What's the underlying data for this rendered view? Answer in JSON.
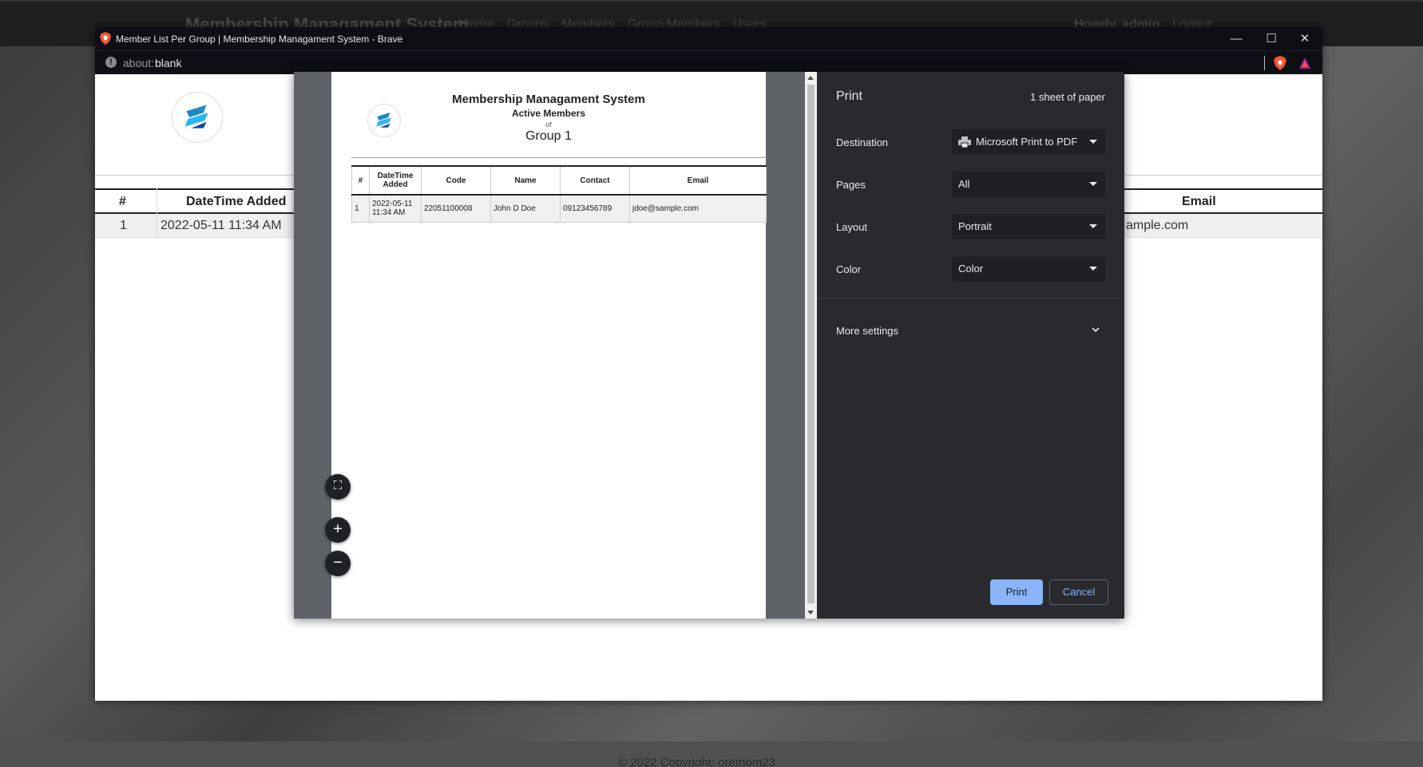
{
  "background_app": {
    "brand": "Membership Managament System",
    "nav": [
      "Home",
      "Groups",
      "Members",
      "Group Members",
      "Users"
    ],
    "user_greeting": "Howdy, admin",
    "logout": "Logout",
    "footer": "© 2022 Copyright: oretnom23"
  },
  "window": {
    "title": "Member List Per Group | Membership Managament System - Brave",
    "address_prefix": "about:",
    "address_value": "blank",
    "controls": {
      "minimize": "—",
      "maximize": "☐",
      "close": "✕"
    }
  },
  "page": {
    "table": {
      "headers": {
        "num": "#",
        "datetime": "DateTime Added",
        "email": "Email"
      },
      "row": {
        "num": "1",
        "datetime": "2022-05-11 11:34 AM",
        "email": "ample.com"
      }
    }
  },
  "print_preview": {
    "doc": {
      "title": "Membership Managament System",
      "subtitle": "Active Members",
      "of": "of",
      "group": "Group 1",
      "columns": [
        "#",
        "DateTime Added",
        "Code",
        "Name",
        "Contact",
        "Email"
      ],
      "rows": [
        [
          "1",
          "2022-05-11 11:34 AM",
          "22051100008",
          "John D Doe",
          "09123456789",
          "jdoe@sample.com"
        ]
      ]
    },
    "fab": {
      "fit": "⛶",
      "zoom_in": "+",
      "zoom_out": "−"
    }
  },
  "print_settings": {
    "title": "Print",
    "sheets": "1 sheet of paper",
    "destination_label": "Destination",
    "destination_value": "Microsoft Print to PDF",
    "pages_label": "Pages",
    "pages_value": "All",
    "layout_label": "Layout",
    "layout_value": "Portrait",
    "color_label": "Color",
    "color_value": "Color",
    "more_settings": "More settings",
    "print_button": "Print",
    "cancel_button": "Cancel"
  },
  "colors": {
    "accent": "#8ab4f8",
    "dialog_bg": "#292a2d",
    "titlebar": "#0d0f14"
  }
}
